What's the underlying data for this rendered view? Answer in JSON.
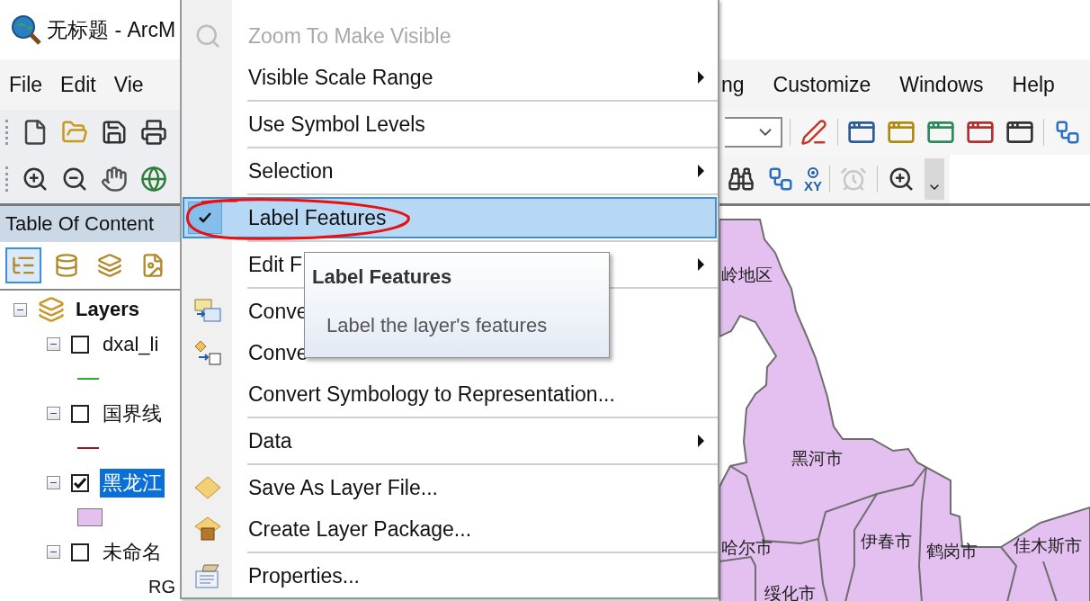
{
  "window": {
    "title": "无标题 - ArcM"
  },
  "menu_bar": {
    "left": [
      "File",
      "Edit",
      "Vie"
    ],
    "right": [
      "ng",
      "Customize",
      "Windows",
      "Help"
    ]
  },
  "tool_bar": {
    "xy_label": "XY",
    "time_button_disabled": true
  },
  "toc": {
    "title": "Table Of Content",
    "tools": [
      {
        "selected": true
      },
      {
        "selected": false
      },
      {
        "selected": false
      },
      {
        "selected": false
      }
    ],
    "root": {
      "name": "Layers",
      "expanded": true,
      "children": [
        {
          "name": "dxal_li",
          "checked": false,
          "selected": false,
          "expanded": true,
          "legend": {
            "kind": "line",
            "color": "#2ea82e"
          }
        },
        {
          "name": "国界线",
          "checked": false,
          "selected": false,
          "expanded": true,
          "legend": {
            "kind": "line",
            "color": "#a01818"
          }
        },
        {
          "name": "黑龙江",
          "checked": true,
          "selected": true,
          "expanded": true,
          "legend": {
            "kind": "fill",
            "color": "#e3c0ef"
          }
        },
        {
          "name": "未命名",
          "checked": false,
          "selected": false,
          "expanded": true,
          "legend": {
            "kind": "text",
            "label": "RG"
          }
        }
      ]
    }
  },
  "map": {
    "labels": [
      "岭地区",
      "黑河市",
      "哈尔市",
      "伊春市",
      "鹤岗市",
      "佳木斯市",
      "绥化市"
    ]
  },
  "context_menu": {
    "items": [
      {
        "kind": "zoom",
        "label": "Zoom To Make Visible",
        "disabled": true,
        "submenu": false,
        "checked": false,
        "selected": false
      },
      {
        "kind": "plain",
        "label": "Visible Scale Range",
        "disabled": false,
        "submenu": true,
        "checked": false,
        "selected": false
      },
      {
        "kind": "separator"
      },
      {
        "kind": "plain",
        "label": "Use Symbol Levels",
        "disabled": false,
        "submenu": false,
        "checked": false,
        "selected": false
      },
      {
        "kind": "separator"
      },
      {
        "kind": "plain",
        "label": "Selection",
        "disabled": false,
        "submenu": true,
        "checked": false,
        "selected": false
      },
      {
        "kind": "separator"
      },
      {
        "kind": "plain",
        "label": "Label Features",
        "disabled": false,
        "submenu": false,
        "checked": true,
        "selected": true
      },
      {
        "kind": "separator"
      },
      {
        "kind": "plain",
        "label": "Edit F",
        "disabled": false,
        "submenu": true,
        "checked": false,
        "selected": false
      },
      {
        "kind": "separator"
      },
      {
        "kind": "annotate",
        "label": "Conve",
        "disabled": false,
        "submenu": false,
        "checked": false,
        "selected": false
      },
      {
        "kind": "graphics",
        "label": "Conve",
        "disabled": false,
        "submenu": false,
        "checked": false,
        "selected": false
      },
      {
        "kind": "plain",
        "label": "Convert Symbology to Representation...",
        "disabled": false,
        "submenu": false,
        "checked": false,
        "selected": false
      },
      {
        "kind": "separator"
      },
      {
        "kind": "plain",
        "label": "Data",
        "disabled": false,
        "submenu": true,
        "checked": false,
        "selected": false
      },
      {
        "kind": "separator"
      },
      {
        "kind": "layerfile",
        "label": "Save As Layer File...",
        "disabled": false,
        "submenu": false,
        "checked": false,
        "selected": false
      },
      {
        "kind": "package",
        "label": "Create Layer Package...",
        "disabled": false,
        "submenu": false,
        "checked": false,
        "selected": false
      },
      {
        "kind": "separator"
      },
      {
        "kind": "properties",
        "label": "Properties...",
        "disabled": false,
        "submenu": false,
        "checked": false,
        "selected": false
      }
    ]
  },
  "tooltip": {
    "title": "Label Features",
    "text": "Label the layer's features"
  }
}
